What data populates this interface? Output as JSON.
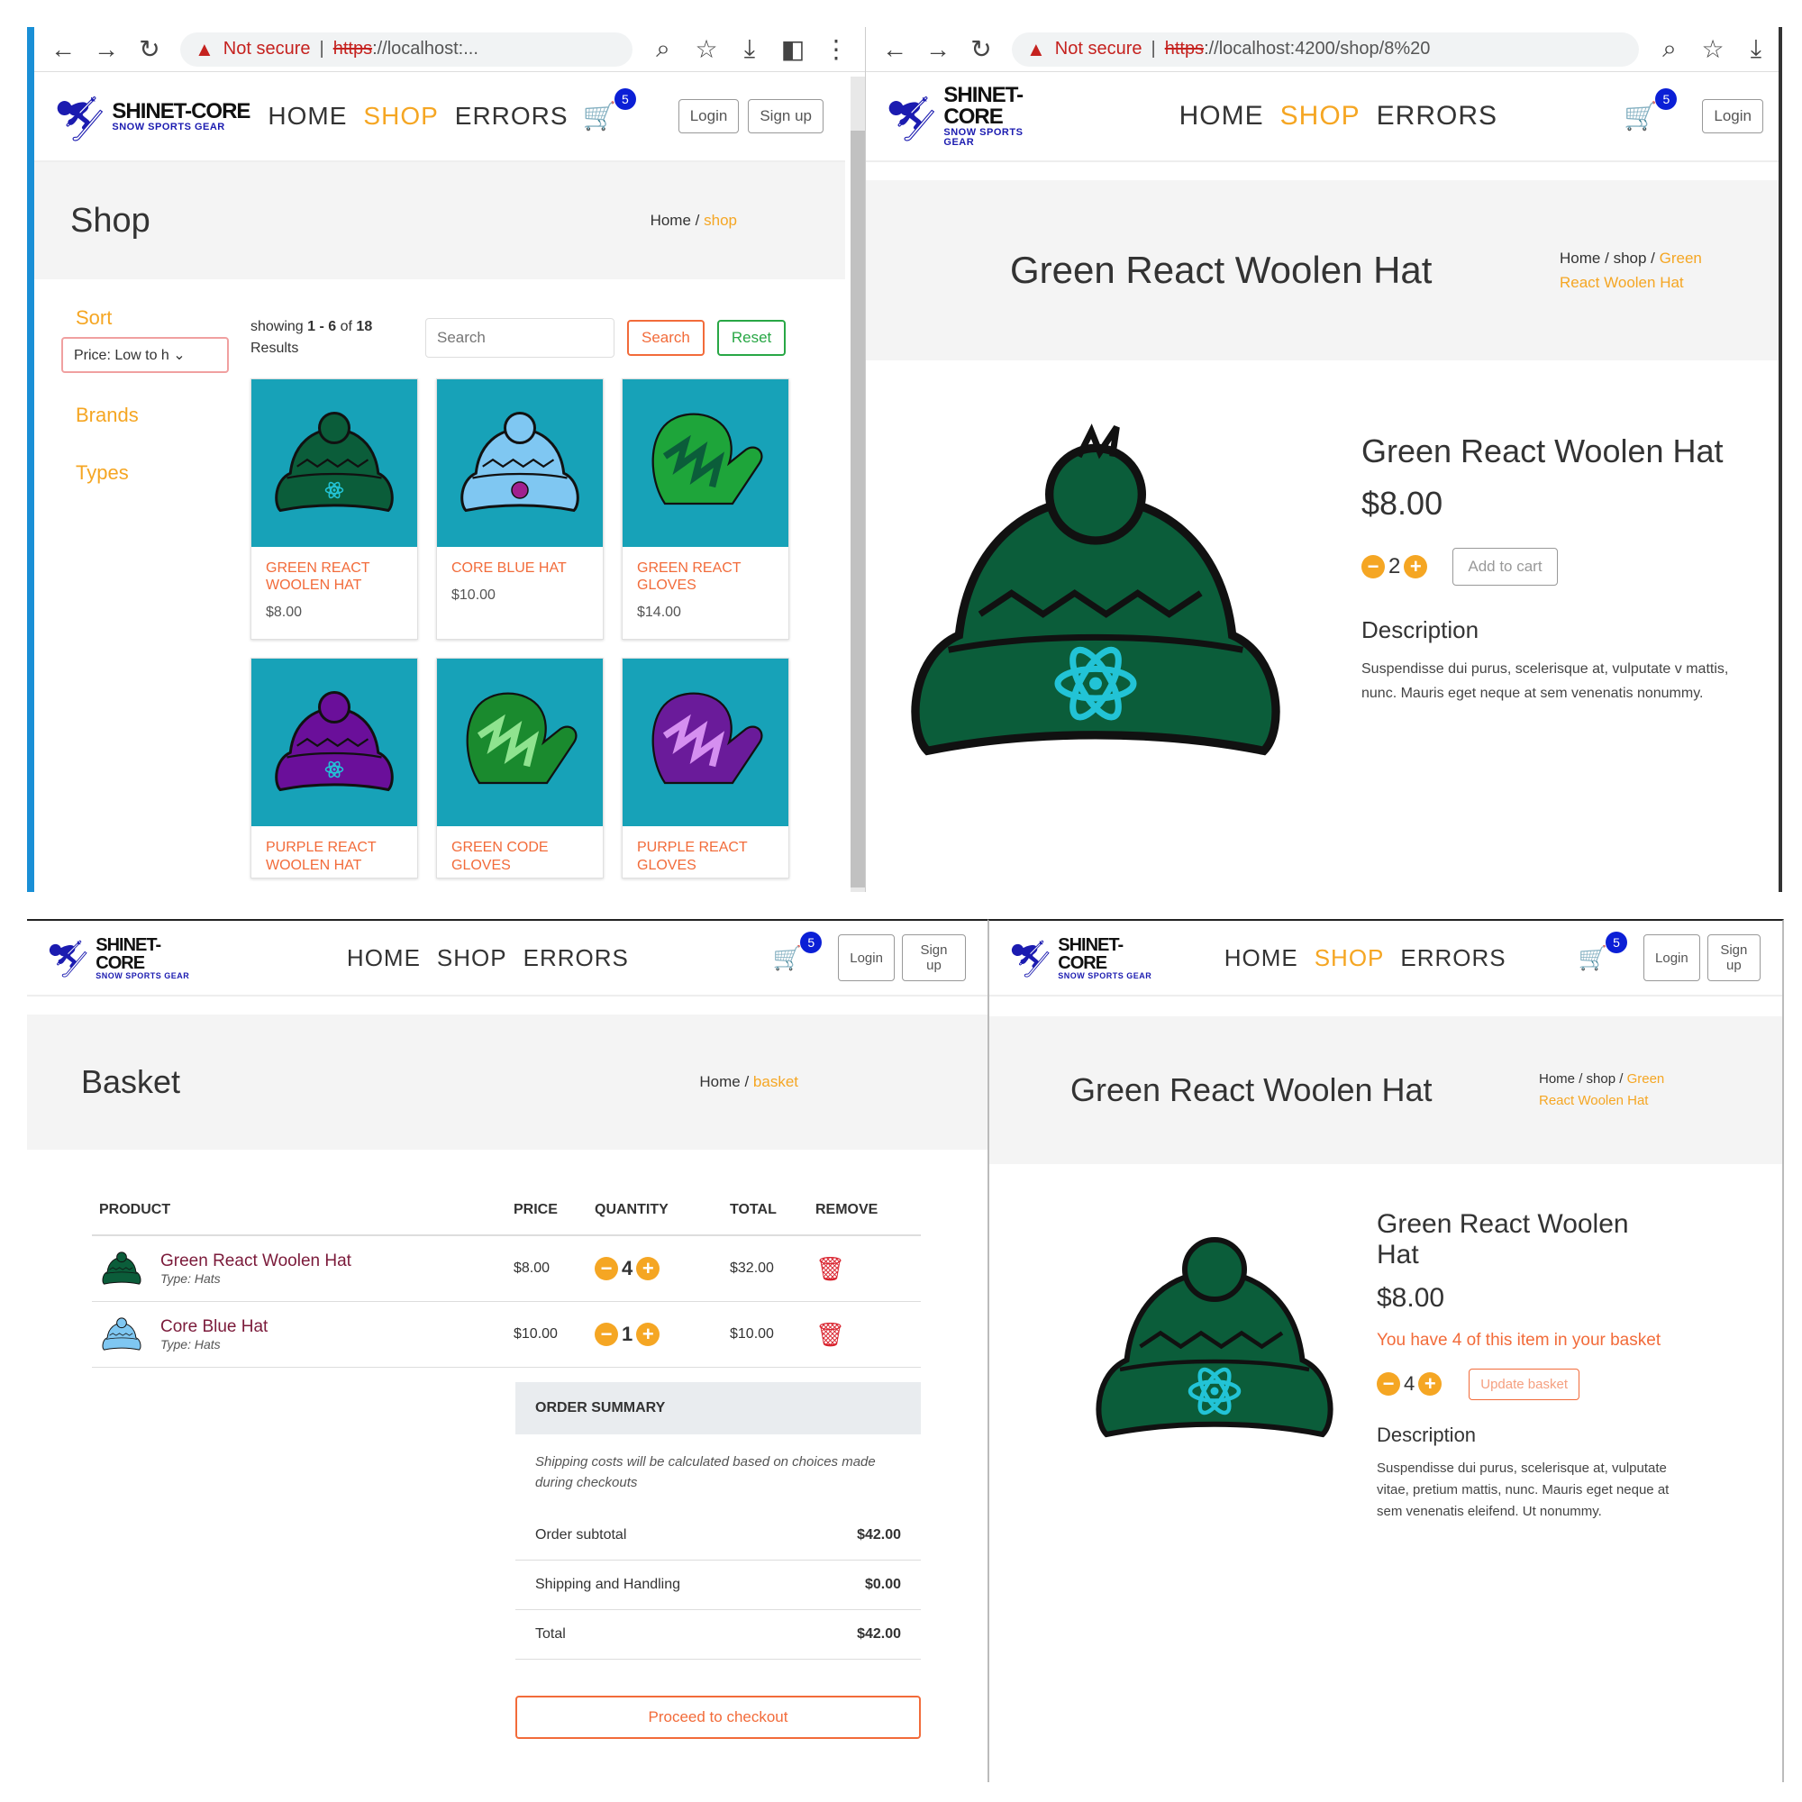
{
  "browser": {
    "not_secure": "Not secure",
    "scheme": "https",
    "url_shop": "://localhost:...",
    "url_product": "://localhost:4200/shop/8%20"
  },
  "logo": {
    "main": "SHINET-CORE",
    "sub": "SNOW SPORTS GEAR"
  },
  "nav": {
    "home": "HOME",
    "shop": "SHOP",
    "errors": "ERRORS",
    "cart_count": "5",
    "login": "Login",
    "signup": "Sign up"
  },
  "shop": {
    "title": "Shop",
    "breadcrumb": {
      "home": "Home",
      "sep": "/",
      "current": "shop"
    },
    "sort_label": "Sort",
    "sort_value": "Price: Low to h",
    "brands_label": "Brands",
    "types_label": "Types",
    "showing_pre": "showing",
    "showing_range": "1 - 6",
    "showing_of": "of",
    "showing_total": "18",
    "showing_post": "Results",
    "search_placeholder": "Search",
    "search_button": "Search",
    "reset_button": "Reset",
    "products": [
      {
        "name": "GREEN REACT WOOLEN HAT",
        "price": "$8.00"
      },
      {
        "name": "CORE BLUE HAT",
        "price": "$10.00"
      },
      {
        "name": "GREEN REACT GLOVES",
        "price": "$14.00"
      },
      {
        "name": "PURPLE REACT WOOLEN HAT",
        "price": ""
      },
      {
        "name": "GREEN CODE GLOVES",
        "price": ""
      },
      {
        "name": "PURPLE REACT GLOVES",
        "price": ""
      }
    ]
  },
  "product": {
    "title": "Green React Woolen Hat",
    "breadcrumb": {
      "home": "Home",
      "shop": "shop",
      "sep": "/",
      "current": "Green React Woolen Hat"
    },
    "name": "Green React Woolen Hat",
    "price": "$8.00",
    "qty": "2",
    "add_button": "Add to cart",
    "desc_heading": "Description",
    "desc_text_a": "Suspendisse dui purus, scelerisque at, vulputate v mattis, nunc. Mauris eget neque at sem venenatis nonummy.",
    "qty_b": "4",
    "in_basket_msg": "You have 4 of this item in your basket",
    "update_button": "Update basket",
    "desc_text_b": "Suspendisse dui purus, scelerisque at, vulputate vitae, pretium mattis, nunc. Mauris eget neque at sem venenatis eleifend. Ut nonummy."
  },
  "basket": {
    "title": "Basket",
    "breadcrumb": {
      "home": "Home",
      "sep": "/",
      "current": "basket"
    },
    "headers": {
      "product": "PRODUCT",
      "price": "PRICE",
      "quantity": "QUANTITY",
      "total": "TOTAL",
      "remove": "REMOVE"
    },
    "items": [
      {
        "name": "Green React Woolen Hat",
        "type": "Type: Hats",
        "price": "$8.00",
        "qty": "4",
        "total": "$32.00"
      },
      {
        "name": "Core Blue Hat",
        "type": "Type: Hats",
        "price": "$10.00",
        "qty": "1",
        "total": "$10.00"
      }
    ],
    "summary": {
      "heading": "ORDER SUMMARY",
      "note": "Shipping costs will be calculated based on choices made during checkouts",
      "subtotal_label": "Order subtotal",
      "subtotal": "$42.00",
      "shipping_label": "Shipping and Handling",
      "shipping": "$0.00",
      "total_label": "Total",
      "total": "$42.00"
    },
    "checkout_button": "Proceed to checkout"
  },
  "icons": {
    "back": "back-arrow-icon",
    "forward": "forward-arrow-icon",
    "reload": "reload-icon",
    "warning": "warning-icon",
    "cart": "cart-icon",
    "trash": "trash-icon",
    "minus": "minus-icon",
    "plus": "plus-icon"
  },
  "colors": {
    "accent": "#f5a623",
    "orange": "#f26b3a",
    "card_bg": "#17a2b8",
    "hat_green": "#0b5d3a",
    "badge": "#0b1fd6"
  }
}
